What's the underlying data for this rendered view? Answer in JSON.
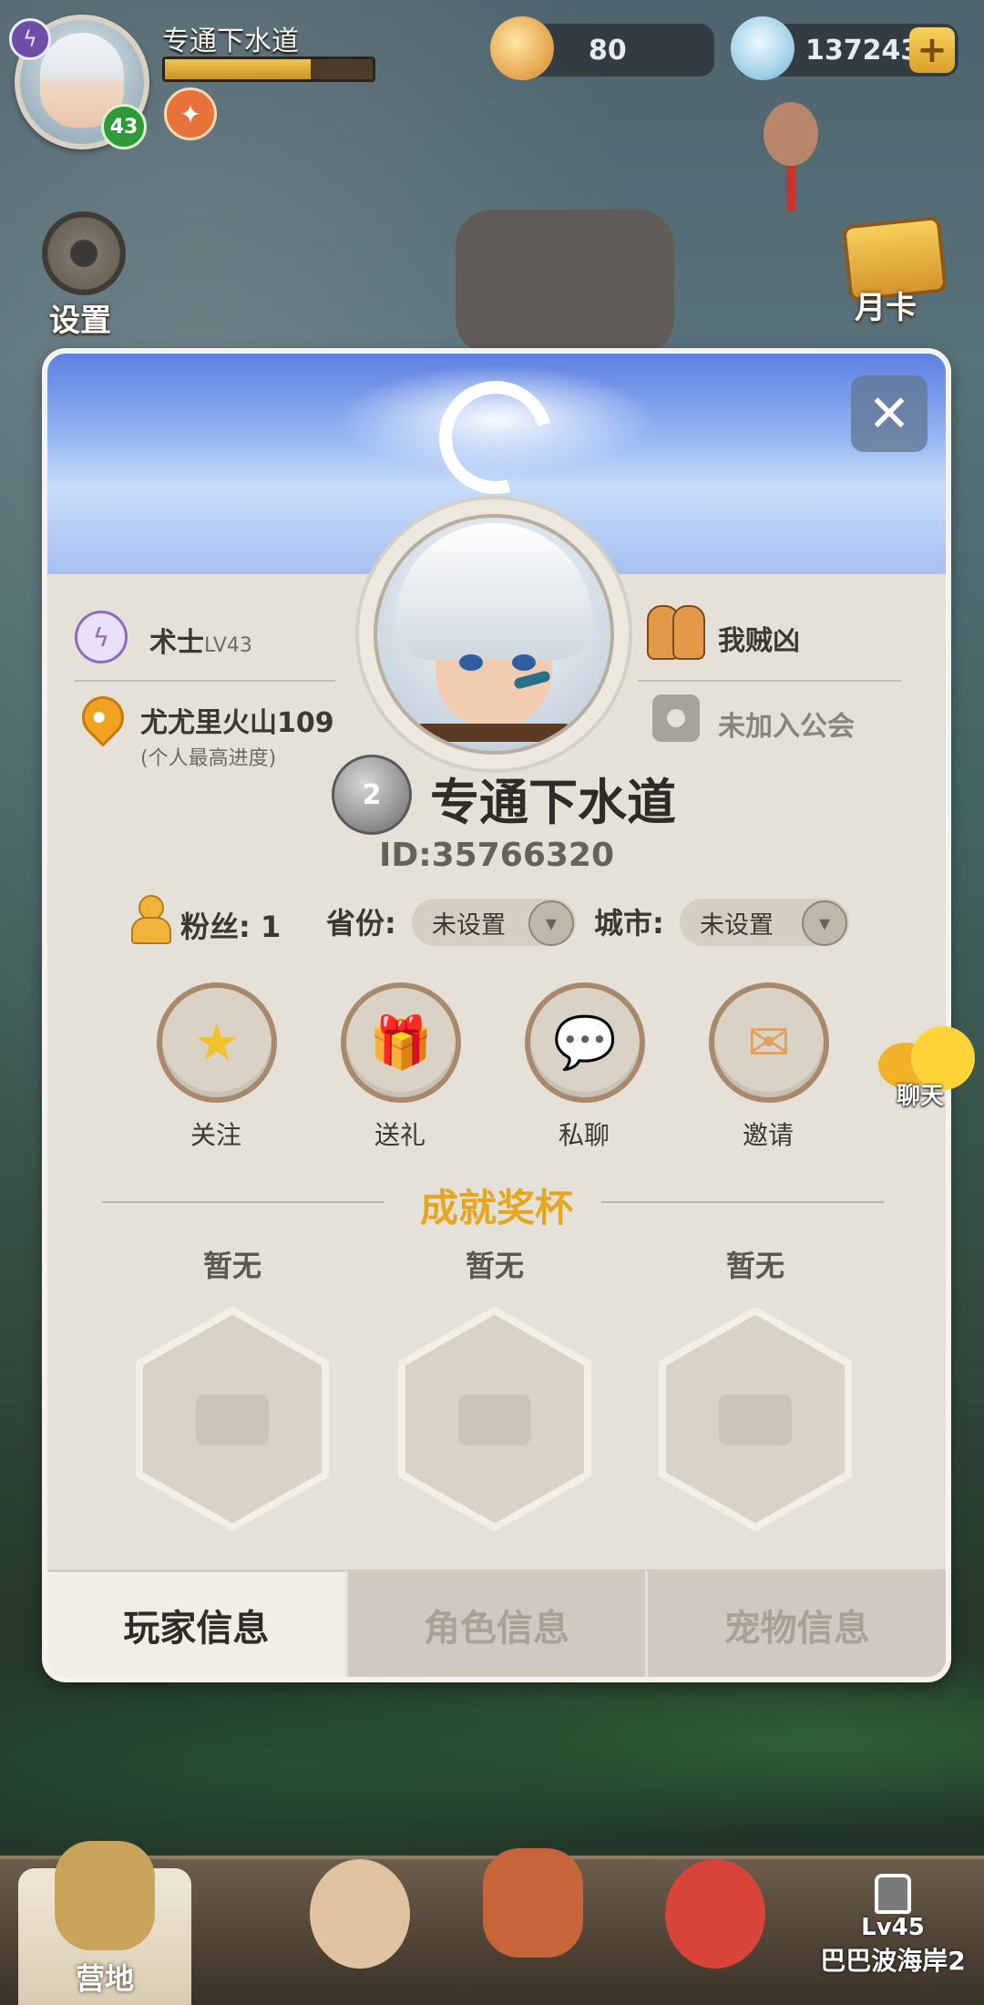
{
  "hud": {
    "player_name": "专通下水道",
    "level": "43",
    "xp_fraction": 0.7,
    "shells": "80",
    "gems": "137243",
    "settings_label": "设置",
    "month_card_label": "月卡"
  },
  "profile": {
    "class_label": "术士",
    "class_level": "LV43",
    "location": "尤尤里火山109",
    "location_note": "(个人最高进度)",
    "partner": "我贼凶",
    "guild": "未加入公会",
    "rank": "2",
    "name": "专通下水道",
    "id": "ID:35766320",
    "fans_label": "粉丝:",
    "fans_count": "1",
    "province_label": "省份:",
    "province_value": "未设置",
    "city_label": "城市:",
    "city_value": "未设置"
  },
  "actions": [
    {
      "label": "关注",
      "icon": "star-icon"
    },
    {
      "label": "送礼",
      "icon": "gift-icon"
    },
    {
      "label": "私聊",
      "icon": "chat-icon"
    },
    {
      "label": "邀请",
      "icon": "mail-icon"
    }
  ],
  "achievements": {
    "title": "成就奖杯",
    "slots": [
      "暂无",
      "暂无",
      "暂无"
    ]
  },
  "tabs": [
    "玩家信息",
    "角色信息",
    "宠物信息"
  ],
  "active_tab": 0,
  "chat_label": "聊天",
  "bottom_nav": {
    "camp_label": "营地",
    "map_level": "Lv45",
    "map_name": "巴巴波海岸2"
  },
  "colors": {
    "accent_gold": "#e3a722",
    "level_green": "#2f9a3a",
    "class_purple": "#8d6ac4"
  }
}
